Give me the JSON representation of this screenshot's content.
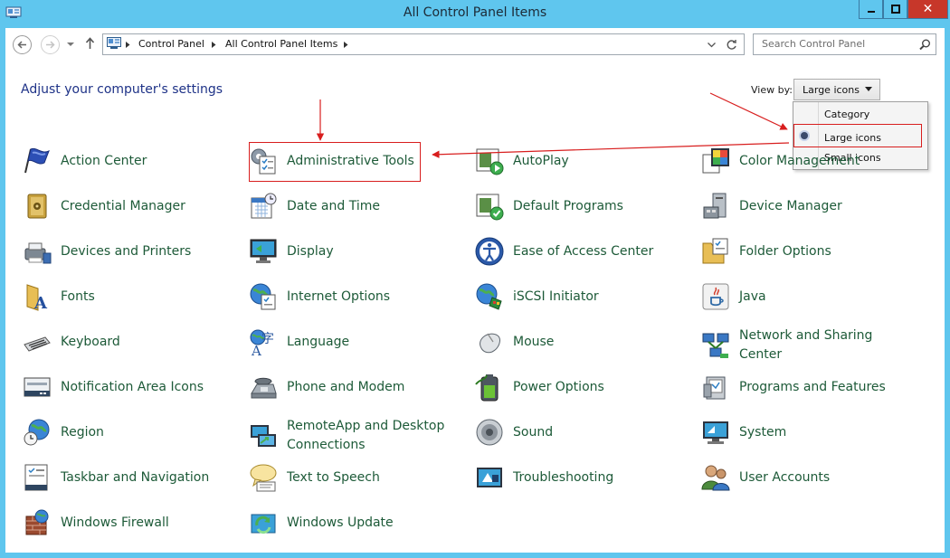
{
  "window": {
    "title": "All Control Panel Items",
    "close_glyph": "✕"
  },
  "address": {
    "crumbs": [
      "Control Panel",
      "All Control Panel Items"
    ]
  },
  "search": {
    "placeholder": "Search Control Panel"
  },
  "heading": "Adjust your computer's settings",
  "view_by": {
    "label": "View by:",
    "selected": "Large icons",
    "options": [
      "Category",
      "Large icons",
      "Small icons"
    ]
  },
  "items": [
    "Action Center",
    "Administrative Tools",
    "AutoPlay",
    "Color Management",
    "Credential Manager",
    "Date and Time",
    "Default Programs",
    "Device Manager",
    "Devices and Printers",
    "Display",
    "Ease of Access Center",
    "Folder Options",
    "Fonts",
    "Internet Options",
    "iSCSI Initiator",
    "Java",
    "Keyboard",
    "Language",
    "Mouse",
    "Network and Sharing Center",
    "Notification Area Icons",
    "Phone and Modem",
    "Power Options",
    "Programs and Features",
    "Region",
    "RemoteApp and Desktop Connections",
    "Sound",
    "System",
    "Taskbar and Navigation",
    "Text to Speech",
    "Troubleshooting",
    "User Accounts",
    "Windows Firewall",
    "Windows Update"
  ],
  "colors": {
    "link": "#1d5a38",
    "heading": "#1e3287",
    "titlebar": "#5fc6ee",
    "annotation": "#d81e1e"
  }
}
